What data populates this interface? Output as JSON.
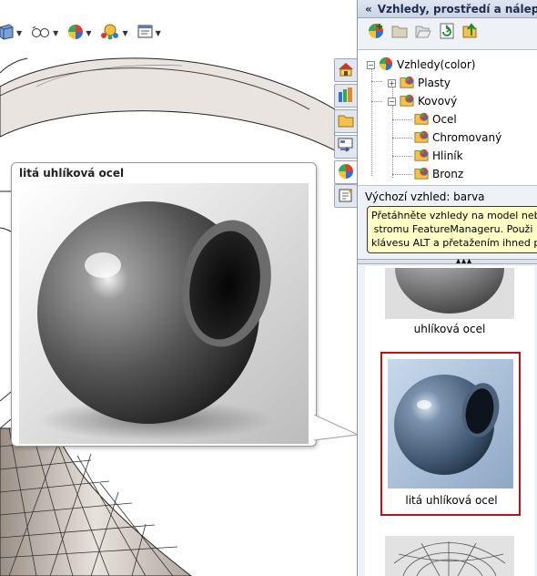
{
  "task_pane": {
    "title": "Vzhledy, prostředí a nálepky",
    "tree": {
      "root": "Vzhledy(color)",
      "items": [
        {
          "label": "Plasty",
          "expanded": false
        },
        {
          "label": "Kovový",
          "expanded": true
        }
      ],
      "children": [
        "Ocel",
        "Chromovaný",
        "Hliník",
        "Bronz"
      ]
    },
    "default_appearance": "Výchozí vzhled: barva",
    "hint_lines": [
      "Přetáhněte vzhledy na model nebo",
      "stromu FeatureManageru.  Použi",
      "klávesu ALT a přetažením ihned pr"
    ],
    "gallery": [
      {
        "label": "uhlíková ocel",
        "selected": false
      },
      {
        "label": "litá uhlíková ocel",
        "selected": true
      },
      {
        "label": "",
        "selected": false
      }
    ]
  },
  "tooltip": {
    "title": "litá uhlíková ocel"
  },
  "icons": {
    "toolbar": [
      "view-orientation-icon",
      "display-style-icon",
      "appearance-icon",
      "scene-icon",
      "render-tools-icon"
    ],
    "pane_tools": [
      "add-appearance-icon",
      "folder-icon",
      "open-folder-icon",
      "refresh-icon",
      "up-level-icon"
    ],
    "side_tabs": [
      "home-icon",
      "design-library-icon",
      "file-explorer-icon",
      "view-palette-icon",
      "appearances-icon",
      "custom-properties-icon"
    ]
  },
  "colors": {
    "selection_border": "#b4151b",
    "hint_background": "#ffffc6",
    "pane_header": "#1e2d4e"
  }
}
